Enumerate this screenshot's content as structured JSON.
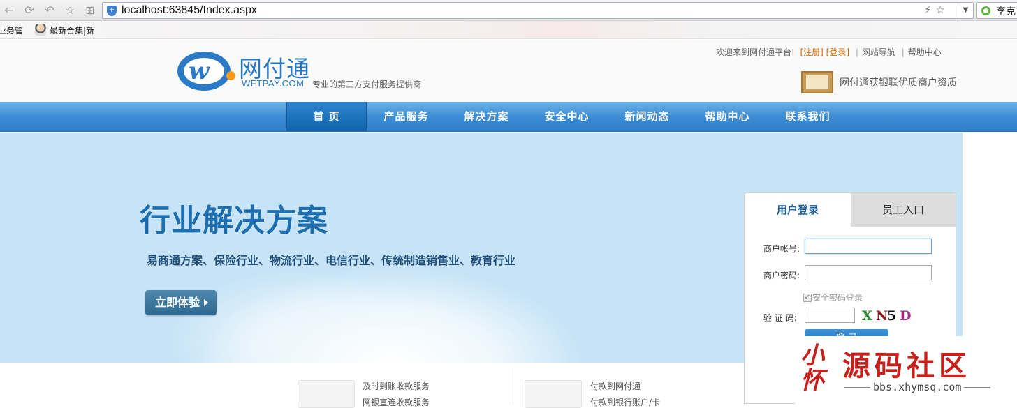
{
  "browser": {
    "url": "localhost:63845/Index.aspx",
    "search_text": "李克",
    "bookmarks": [
      "业务管",
      "最新合集|新"
    ]
  },
  "header": {
    "logo_cn": "网付通",
    "logo_en": "WFTPAY.COM",
    "slogan": "专业的第三方支付服务提供商",
    "welcome": "欢迎来到网付通平台!",
    "register": "[注册]",
    "login": "[登录]",
    "site_nav": "网站导航",
    "help": "帮助中心",
    "cert_text": "网付通获银联优质商户资质"
  },
  "nav": {
    "items": [
      "首 页",
      "产品服务",
      "解决方案",
      "安全中心",
      "新闻动态",
      "帮助中心",
      "联系我们"
    ]
  },
  "banner": {
    "title": "行业解决方案",
    "subtitle": "易商通方案、保险行业、物流行业、电信行业、传统制造销售业、教育行业",
    "button": "立即体验"
  },
  "login_box": {
    "tab_user": "用户登录",
    "tab_staff": "员工入口",
    "account_label": "商户帐号:",
    "password_label": "商户密码:",
    "secure_label": "安全密码登录",
    "captcha_label": "验 证 码:",
    "captcha_chars": [
      "X",
      "N",
      "5",
      "D"
    ],
    "captcha_colors": [
      "#2e8b2e",
      "#8b1a1a",
      "#111111",
      "#9b2d7a"
    ],
    "submit": "登 录"
  },
  "services": [
    {
      "line1": "及时到账收款服务",
      "line2": "网银直连收款服务"
    },
    {
      "line1": "付款到网付通",
      "line2": "付款到银行账户/卡"
    }
  ],
  "watermark": {
    "seal": "小 怀",
    "title": "源码社区",
    "site": "bbs.xhymsq.com"
  }
}
